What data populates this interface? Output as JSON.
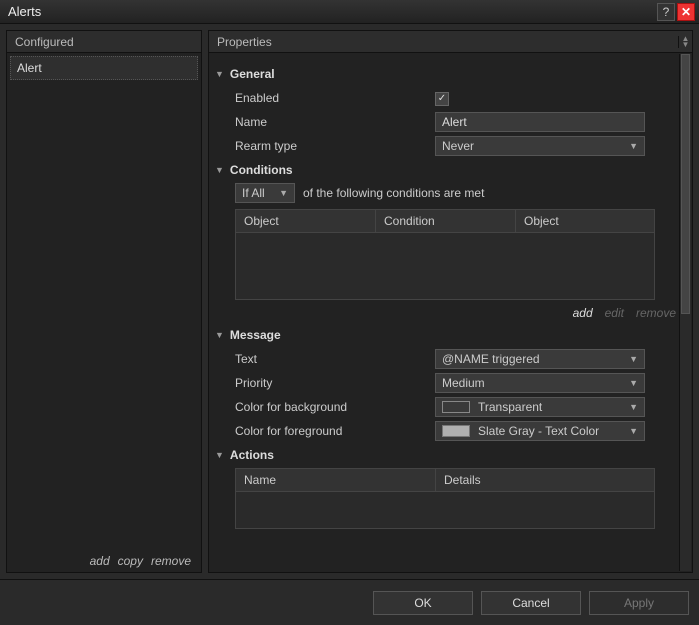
{
  "window_title": "Alerts",
  "left": {
    "header": "Configured",
    "items": [
      "Alert"
    ],
    "actions": {
      "add": "add",
      "copy": "copy",
      "remove": "remove"
    }
  },
  "right": {
    "header": "Properties",
    "general": {
      "title": "General",
      "enabled_label": "Enabled",
      "enabled_checked": "✓",
      "name_label": "Name",
      "name_value": "Alert",
      "rearm_label": "Rearm type",
      "rearm_value": "Never"
    },
    "conditions": {
      "title": "Conditions",
      "mode": "If All",
      "suffix": "of the following conditions are met",
      "cols": [
        "Object",
        "Condition",
        "Object"
      ],
      "actions": {
        "add": "add",
        "edit": "edit",
        "remove": "remove"
      }
    },
    "message": {
      "title": "Message",
      "text_label": "Text",
      "text_value": "@NAME triggered",
      "priority_label": "Priority",
      "priority_value": "Medium",
      "bg_label": "Color for background",
      "bg_value": "Transparent",
      "bg_swatch": "#00000000",
      "fg_label": "Color for foreground",
      "fg_value": "Slate Gray - Text Color",
      "fg_swatch": "#b0b0b0"
    },
    "actions": {
      "title": "Actions",
      "cols": [
        "Name",
        "Details"
      ]
    }
  },
  "footer": {
    "ok": "OK",
    "cancel": "Cancel",
    "apply": "Apply"
  }
}
